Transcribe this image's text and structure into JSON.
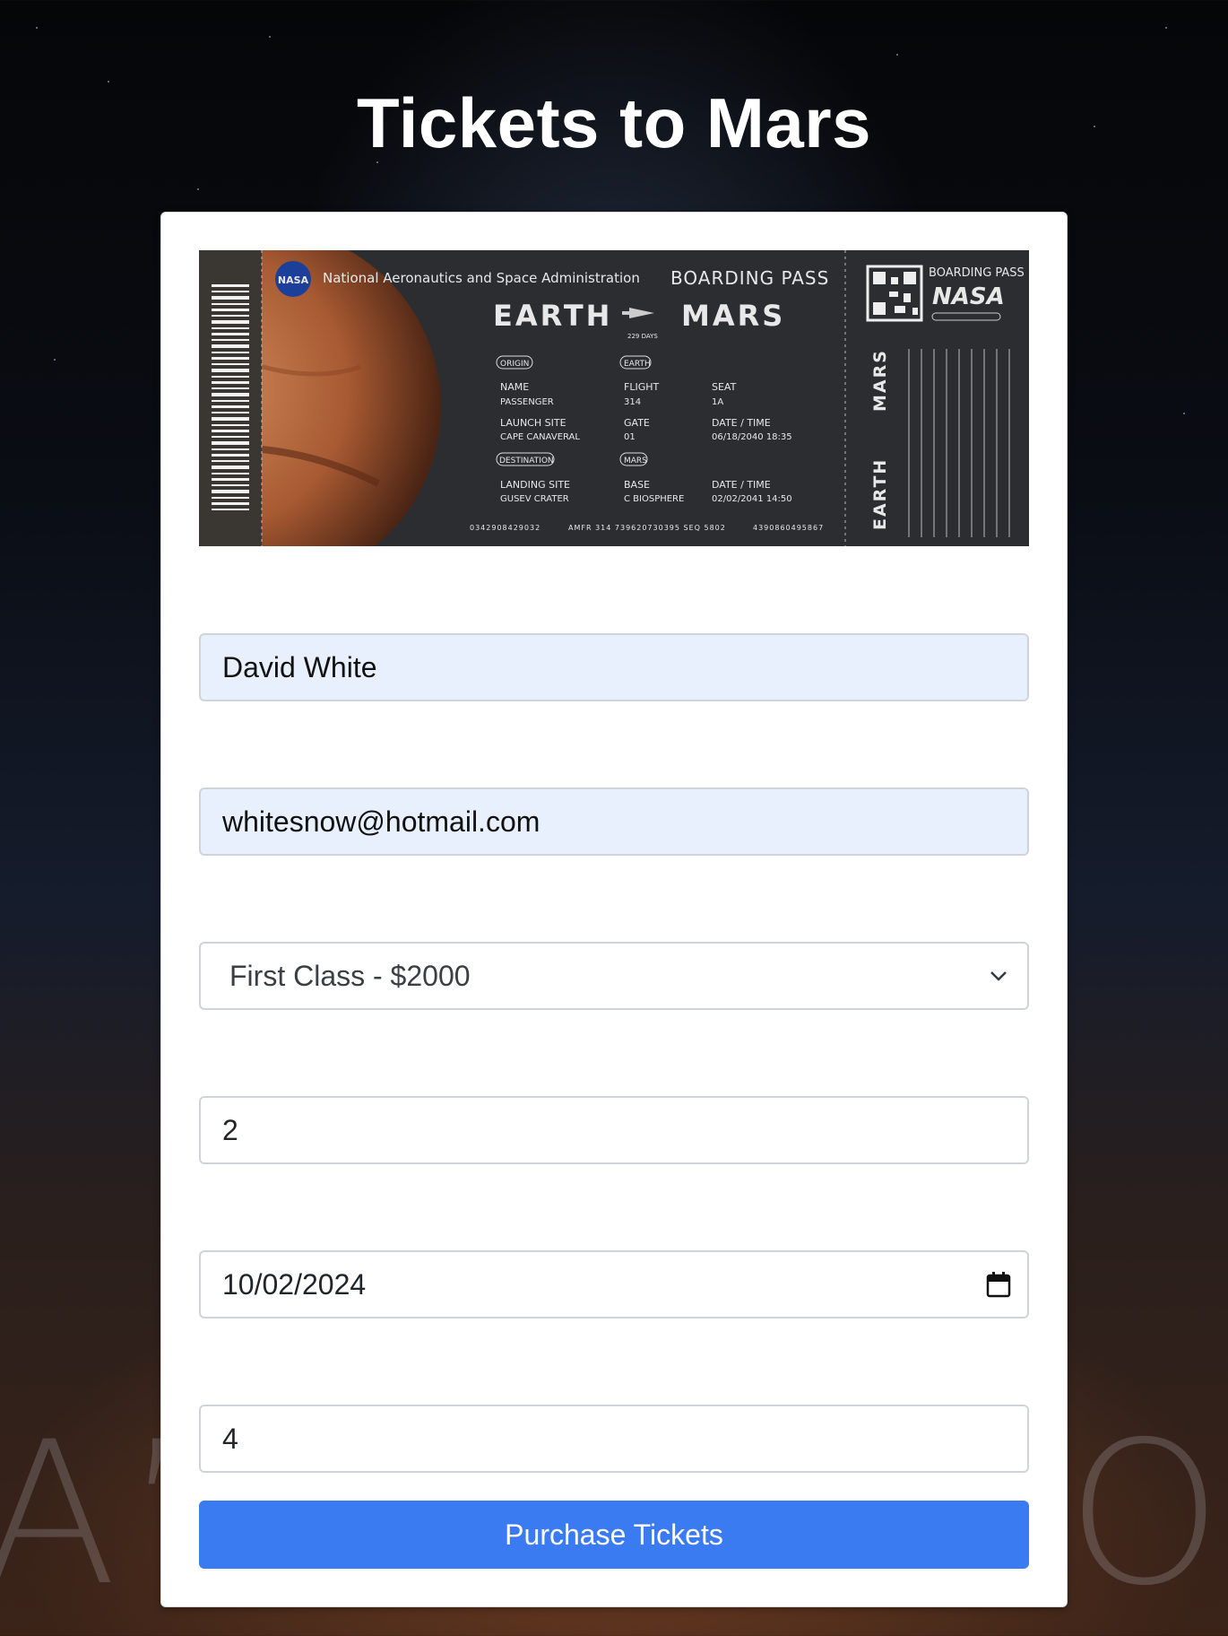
{
  "page": {
    "title": "Tickets to Mars"
  },
  "ticket": {
    "agency": "National Aeronautics and Space Administration",
    "boarding_pass": "BOARDING PASS",
    "origin_city": "EARTH",
    "dest_city": "MARS",
    "duration": "229 DAYS",
    "origin_tag": "ORIGIN",
    "earth_tag": "EARTH",
    "destination_tag": "DESTINATION",
    "mars_tag": "MARS",
    "name_label": "NAME",
    "name_value": "PASSENGER",
    "flight_label": "FLIGHT",
    "flight_value": "314",
    "seat_label": "SEAT",
    "seat_value": "1A",
    "launch_label": "LAUNCH SITE",
    "launch_value": "CAPE CANAVERAL",
    "gate_label": "GATE",
    "gate_value": "01",
    "datetime_label": "DATE / TIME",
    "depart_value": "06/18/2040 18:35",
    "landing_label": "LANDING SITE",
    "landing_value": "GUSEV CRATER",
    "base_label": "BASE",
    "base_value": "C BIOSPHERE",
    "arrive_value": "02/02/2041 14:50",
    "footer_code1": "0342908429032",
    "footer_code2": "AMFR 314 739620730395 SEQ 5802",
    "footer_code3": "4390860495867",
    "nasa_logo": "NASA",
    "stub_boarding_pass": "BOARDING PASS",
    "stub_nasa_wordmark": "NASA",
    "stub_mars": "MARS",
    "stub_earth": "EARTH"
  },
  "form": {
    "name_value": "David White",
    "email_value": "whitesnow@hotmail.com",
    "class_selected": "First Class - $2000",
    "quantity_value": "2",
    "date_value": "10/02/2024",
    "extra_value": "4",
    "submit_label": "Purchase Tickets"
  },
  "background": {
    "letters_left": "A’S",
    "letters_right": "O"
  },
  "colors": {
    "accent": "#3b7bf2",
    "autofill": "#e8f0fe",
    "ticket_bg": "#2a2c2f"
  },
  "icons": {
    "select": "chevron-down-icon",
    "date": "calendar-icon"
  }
}
